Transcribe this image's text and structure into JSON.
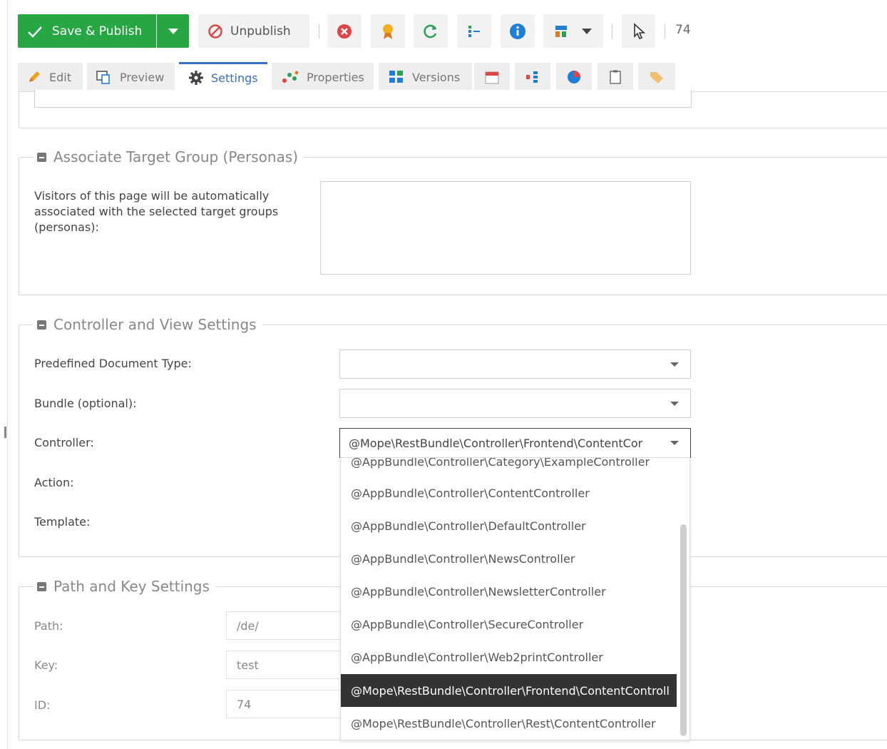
{
  "toolbar": {
    "save_publish_label": "Save & Publish",
    "unpublish_label": "Unpublish",
    "document_id": "74",
    "colors": {
      "save_green": "#27a744",
      "delete_red": "#e04444",
      "info_blue": "#1f7ed6",
      "refresh_green": "#2aa05a"
    }
  },
  "tabs": [
    {
      "label": "Edit",
      "icon": "pencil-icon"
    },
    {
      "label": "Preview",
      "icon": "preview-icon"
    },
    {
      "label": "Settings",
      "icon": "gear-icon"
    },
    {
      "label": "Properties",
      "icon": "properties-icon"
    },
    {
      "label": "Versions",
      "icon": "versions-icon"
    },
    {
      "label": "",
      "icon": "calendar-icon"
    },
    {
      "label": "",
      "icon": "dependencies-icon"
    },
    {
      "label": "",
      "icon": "reports-icon"
    },
    {
      "label": "",
      "icon": "notes-icon"
    },
    {
      "label": "",
      "icon": "tag-icon"
    }
  ],
  "personas": {
    "legend": "Associate Target Group (Personas)",
    "description": "Visitors of this page will be automatically associated with the selected target groups (personas):"
  },
  "controller_settings": {
    "legend": "Controller and View Settings",
    "predefined_label": "Predefined Document Type:",
    "bundle_label": "Bundle (optional):",
    "controller_label": "Controller:",
    "controller_value": "@Mope\\RestBundle\\Controller\\Frontend\\ContentCor",
    "action_label": "Action:",
    "template_label": "Template:"
  },
  "path_settings": {
    "legend": "Path and Key Settings",
    "path_label": "Path:",
    "path_value": "/de/",
    "key_label": "Key:",
    "key_value": "test",
    "id_label": "ID:",
    "id_value": "74"
  },
  "controller_options": [
    "@AppBundle\\Controller\\Category\\ExampleController",
    "@AppBundle\\Controller\\ContentController",
    "@AppBundle\\Controller\\DefaultController",
    "@AppBundle\\Controller\\NewsController",
    "@AppBundle\\Controller\\NewsletterController",
    "@AppBundle\\Controller\\SecureController",
    "@AppBundle\\Controller\\Web2printController",
    "@Mope\\RestBundle\\Controller\\Frontend\\ContentControll",
    "@Mope\\RestBundle\\Controller\\Rest\\ContentController"
  ]
}
